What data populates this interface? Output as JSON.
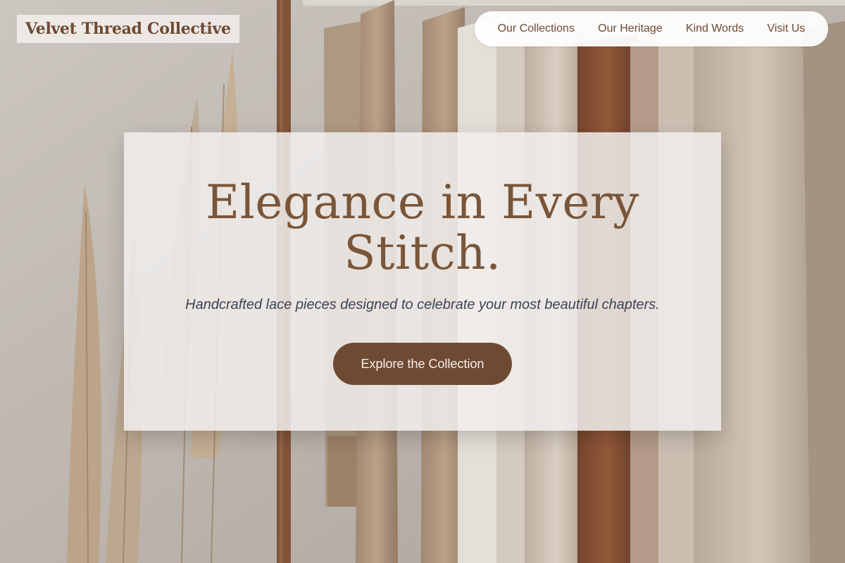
{
  "brand": {
    "name": "Velvet Thread Collective"
  },
  "nav": {
    "items": [
      {
        "label": "Our Collections"
      },
      {
        "label": "Our Heritage"
      },
      {
        "label": "Kind Words"
      },
      {
        "label": "Visit Us"
      }
    ]
  },
  "hero": {
    "title": "Elegance in Every Stitch.",
    "subtitle": "Handcrafted lace pieces designed to celebrate your most beautiful chapters.",
    "cta_label": "Explore the Collection",
    "background_image": "clothing-rack-photo"
  },
  "colors": {
    "brand_brown": "#6f4a33",
    "title_brown": "#7a5538",
    "subtitle_slate": "#3d4452",
    "card_bg": "#f0eeec"
  }
}
